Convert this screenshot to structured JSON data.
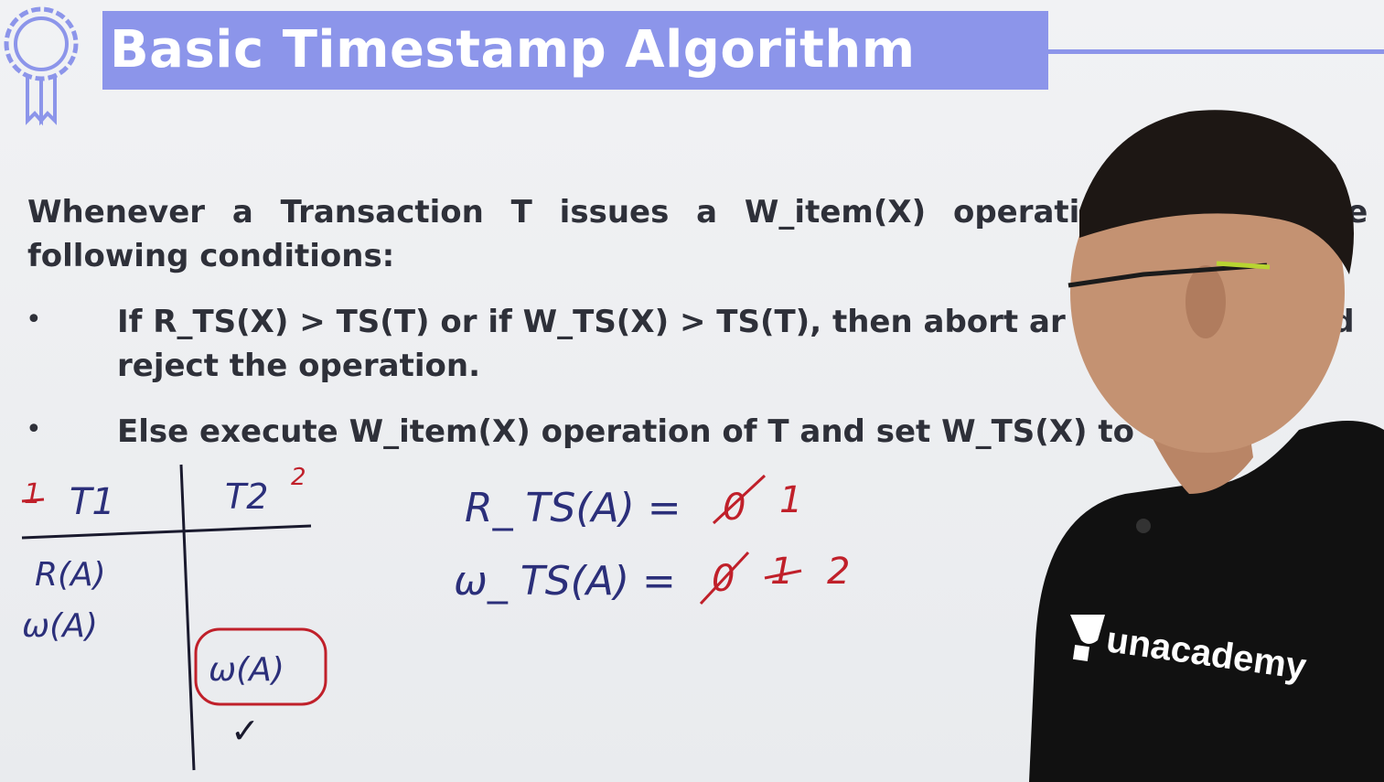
{
  "slide": {
    "title": "Basic Timestamp Algorithm",
    "intro_line1": "Whenever a Transaction T issues a W_item(X) operati",
    "intro_line1_tail": "ne",
    "intro_line2": "following conditions:",
    "bullet_symbol": "•",
    "bullet1_line1": "If R_TS(X) > TS(T) or if W_TS(X) > TS(T), then abort ar",
    "bullet1_line1_tail": "nd",
    "bullet1_line2": "reject the operation.",
    "bullet2_line1": "Else execute W_item(X) operation of T and set W_TS(X) to"
  },
  "handwriting": {
    "t1_number": "1",
    "t1_label": "T1",
    "t2_label": "T2",
    "t2_number": "2",
    "row1_op": "R(A)",
    "row2_op": "ω(A)",
    "t2_op": "ω(A)",
    "check_mark": "✓",
    "rts_label": "R_ TS(A) =",
    "rts_old": "0",
    "rts_new": "1",
    "wts_label": "ω_ TS(A) =",
    "wts_old1": "0",
    "wts_old2": "1",
    "wts_new": "2"
  },
  "shirt_logo": "unacademy",
  "colors": {
    "title_bar": "#8c95ea",
    "text": "#2e3039",
    "ink_blue": "#2b2f7a",
    "ink_red": "#c0202a",
    "shirt": "#111111"
  }
}
